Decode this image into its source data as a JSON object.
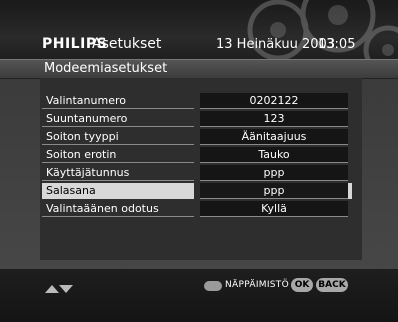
{
  "header": {
    "brand": "PHILIPS",
    "section": "Asetukset",
    "date": "13 Heinäkuu 2003",
    "time": "13:05"
  },
  "title": "Modeemiasetukset",
  "settings": [
    {
      "label": "Valintanumero",
      "value": "0202122"
    },
    {
      "label": "Suuntanumero",
      "value": "123"
    },
    {
      "label": "Soiton tyyppi",
      "value": "Äänitaajuus"
    },
    {
      "label": "Soiton erotin",
      "value": "Tauko"
    },
    {
      "label": "Käyttäjätunnus",
      "value": "ppp"
    },
    {
      "label": "Salasana",
      "value": "ppp",
      "selected": true
    },
    {
      "label": "Valintaäänen odotus",
      "value": "Kyllä"
    }
  ],
  "footer": {
    "nav_icon": "up-down-arrows-icon",
    "keyboard_icon": "keyboard-icon",
    "keyboard_label": "NÄPPÄIMISTÖ",
    "ok_label": "OK",
    "back_label": "BACK"
  },
  "colors": {
    "selection": "#d8d8d8",
    "value_bg": "#151515"
  }
}
